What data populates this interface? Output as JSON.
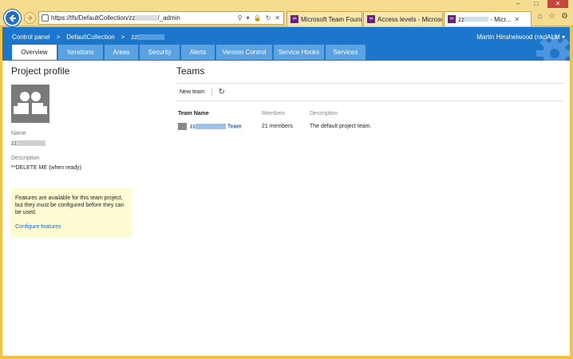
{
  "browser": {
    "url": "https://tfs/DefaultCollection/zz",
    "url_suffix": "/_admin",
    "tabs": [
      {
        "label": "Microsoft Team Found..."
      },
      {
        "label": "Access levels - Microso..."
      },
      {
        "label": "zz",
        "label_suffix": " - Micr..."
      }
    ]
  },
  "header": {
    "breadcrumb": [
      "Control panel",
      ">",
      "DefaultCollection",
      ">",
      "zz"
    ],
    "user": "Martin Hinshelwood (nkdALM"
  },
  "nav_tabs": [
    {
      "label": "Overview",
      "active": true
    },
    {
      "label": "Iterations"
    },
    {
      "label": "Areas"
    },
    {
      "label": "Security"
    },
    {
      "label": "Alerts"
    },
    {
      "label": "Version Control"
    },
    {
      "label": "Service Hooks"
    },
    {
      "label": "Services"
    }
  ],
  "profile": {
    "title": "Project profile",
    "name_label": "Name",
    "name_value": "zz",
    "description_label": "Description",
    "description_value": "**DELETE ME (when ready)"
  },
  "notice": {
    "text": "Features are available for this team project, but they must be configured before they can be used.",
    "link": "Configure features"
  },
  "teams": {
    "title": "Teams",
    "new_team": "New team",
    "columns": [
      "Team Name",
      "Members",
      "Description"
    ],
    "rows": [
      {
        "name_prefix": "zz",
        "name_suffix": " Team",
        "members": "21 members",
        "description": "The default project team."
      }
    ]
  },
  "colors": {
    "accent": "#1b76cc",
    "tab": "#5ba2e2",
    "frame": "#f0c24a",
    "notice": "#fdfbd2"
  }
}
